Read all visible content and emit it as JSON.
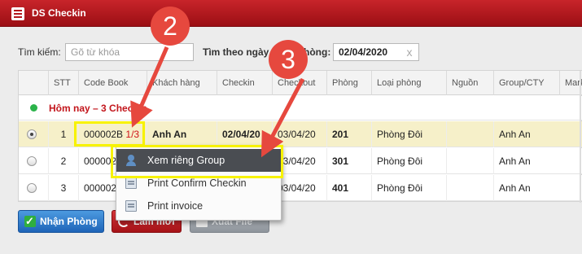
{
  "window": {
    "title": "DS Checkin",
    "title_icon": "list-icon"
  },
  "search": {
    "label": "Tìm kiếm:",
    "placeholder": "Gõ từ khóa",
    "value": ""
  },
  "date_filter": {
    "label": "Tìm theo ngày nhận phòng:",
    "value": "02/04/2020",
    "clear": "x"
  },
  "table": {
    "columns": [
      "STT",
      "Code Book",
      "Khách hàng",
      "Checkin",
      "Checkout",
      "Phòng",
      "Loại phòng",
      "Nguồn",
      "Group/CTY",
      "Mark"
    ],
    "group": {
      "label": "Hôm nay – ",
      "count": "3 Checkin"
    },
    "rows": [
      {
        "stt": "1",
        "code": "000002B",
        "group_frac": "1/3",
        "customer": "Anh An",
        "checkin": "02/04/20",
        "checkout": "03/04/20",
        "room": "201",
        "room_type": "Phòng Đôi",
        "source": "",
        "group": "Anh An",
        "selected": true
      },
      {
        "stt": "2",
        "code": "000002B",
        "group_frac": "",
        "customer": "",
        "checkin": "",
        "checkout": "03/04/20",
        "room": "301",
        "room_type": "Phòng Đôi",
        "source": "",
        "group": "Anh An",
        "selected": false
      },
      {
        "stt": "3",
        "code": "000002B",
        "group_frac": "",
        "customer": "",
        "checkin": "",
        "checkout": "03/04/20",
        "room": "401",
        "room_type": "Phòng Đôi",
        "source": "",
        "group": "Anh An",
        "selected": false
      }
    ]
  },
  "context_menu": {
    "items": [
      {
        "label": "Xem riêng Group",
        "icon": "user-icon",
        "active": true
      },
      {
        "label": "Print Confirm Checkin",
        "icon": "printer-icon",
        "active": false
      },
      {
        "label": "Print invoice",
        "icon": "printer-icon",
        "active": false
      }
    ]
  },
  "buttons": {
    "receive": "Nhận Phòng",
    "reload": "Làm mới",
    "export": "Xuất File"
  },
  "annotations": {
    "step_2": "2",
    "step_3": "3"
  },
  "colors": {
    "title_bar": "#b3161c",
    "highlight": "#f7f200",
    "badge": "#e6483e",
    "selected_row": "#f6f0c9"
  }
}
